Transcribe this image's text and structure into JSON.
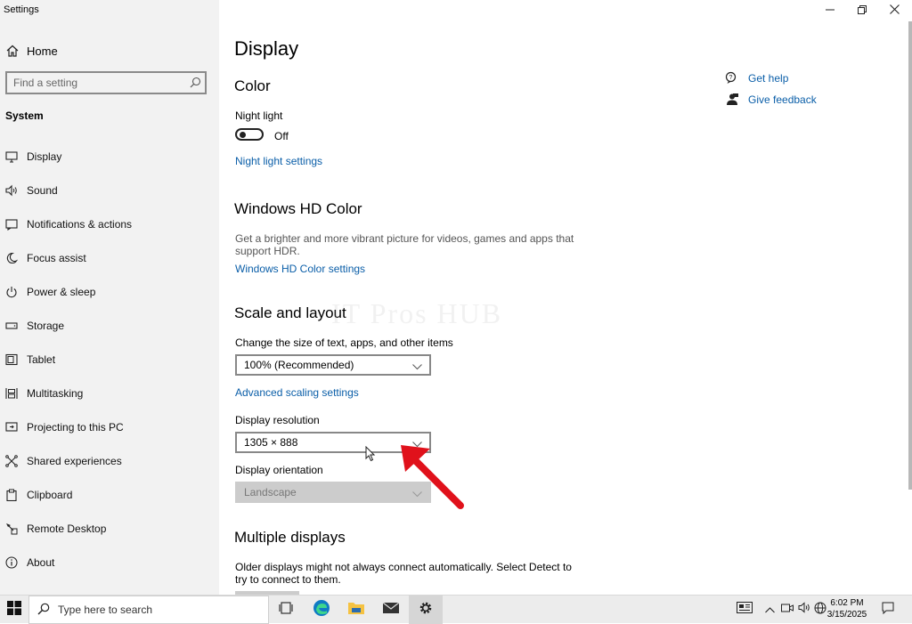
{
  "window": {
    "title": "Settings",
    "minimize_icon": "minimize-icon",
    "maximize_icon": "restore-icon",
    "close_icon": "close-icon"
  },
  "sidebar": {
    "home_label": "Home",
    "search_placeholder": "Find a setting",
    "section_label": "System",
    "items": [
      {
        "label": "Display",
        "icon": "monitor-icon"
      },
      {
        "label": "Sound",
        "icon": "speaker-icon"
      },
      {
        "label": "Notifications & actions",
        "icon": "notification-icon"
      },
      {
        "label": "Focus assist",
        "icon": "moon-icon"
      },
      {
        "label": "Power & sleep",
        "icon": "power-icon"
      },
      {
        "label": "Storage",
        "icon": "storage-icon"
      },
      {
        "label": "Tablet",
        "icon": "tablet-icon"
      },
      {
        "label": "Multitasking",
        "icon": "multitasking-icon"
      },
      {
        "label": "Projecting to this PC",
        "icon": "projecting-icon"
      },
      {
        "label": "Shared experiences",
        "icon": "shared-experiences-icon"
      },
      {
        "label": "Clipboard",
        "icon": "clipboard-icon"
      },
      {
        "label": "Remote Desktop",
        "icon": "remote-desktop-icon"
      },
      {
        "label": "About",
        "icon": "info-icon"
      }
    ]
  },
  "main": {
    "page_title": "Display",
    "color": {
      "heading": "Color",
      "night_light_label": "Night light",
      "night_light_state": "Off",
      "night_light_settings_link": "Night light settings"
    },
    "hdr": {
      "heading": "Windows HD Color",
      "description_line1": "Get a brighter and more vibrant picture for videos, games and apps that",
      "description_line2": "support HDR.",
      "settings_link": "Windows HD Color settings"
    },
    "scale": {
      "heading": "Scale and layout",
      "size_label": "Change the size of text, apps, and other items",
      "size_value": "100% (Recommended)",
      "advanced_link": "Advanced scaling settings",
      "resolution_label": "Display resolution",
      "resolution_value": "1305 × 888",
      "orientation_label": "Display orientation",
      "orientation_value": "Landscape"
    },
    "multiple": {
      "heading": "Multiple displays",
      "description_line1": "Older displays might not always connect automatically. Select Detect to",
      "description_line2": "try to connect to them."
    },
    "watermark": "IT Pros HUB",
    "get_help": "Get help",
    "give_feedback": "Give feedback"
  },
  "taskbar": {
    "search_placeholder": "Type here to search",
    "time": "6:02 PM",
    "date": "3/15/2025"
  },
  "colors": {
    "accent": "#0a5ea8",
    "arrow": "#e0111b",
    "sidebar_bg": "#f2f2f2"
  }
}
